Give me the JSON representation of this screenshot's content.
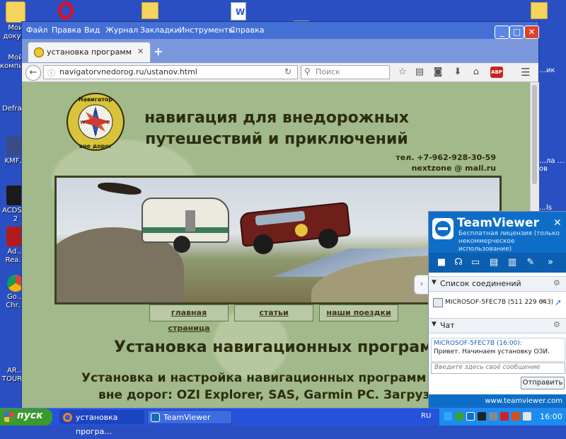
{
  "desktop": {
    "icons_left": [
      "Мои доку…",
      "Мой компью…",
      "Defra…",
      "KMF…",
      "ACDS… 2",
      "Ad… Rea…",
      "Go… Chr…",
      "AR… TOUR…"
    ],
    "icons_right": [
      "…ик",
      "…ла …ов",
      "…ls"
    ]
  },
  "firefox": {
    "menu": [
      "Файл",
      "Правка",
      "Вид",
      "Журнал",
      "Закладки",
      "Инструменты",
      "Справка"
    ],
    "tab_title": "установка программ",
    "url": "navigatorvnedorog.ru/ustanov.html",
    "search_placeholder": "Поиск",
    "abp_badge": "ABP"
  },
  "page": {
    "logo_top": "Навигатор",
    "logo_bottom": "вне дорог",
    "compass_letters": {
      "n": "N",
      "s": "S",
      "e": "E",
      "w": "W"
    },
    "headline_line1": "навигация для внедорожных",
    "headline_line2": "путешествий и приключений",
    "phone": "тел. +7-962-928-30-59",
    "email": "nextzone @ mail.ru",
    "nav": [
      "главная страница",
      "статьи",
      "наши поездки"
    ],
    "title": "Установка навигационных програм",
    "subtitle_line1": "Установка и настройка навигационных программ дл",
    "subtitle_line2": "вне дорог: OZI Explorer, SAS, Garmin PC. Загрузка"
  },
  "teamviewer": {
    "brand": "TeamViewer",
    "license": "Бесплатная лицензия (только некоммерческое использование)",
    "connections_header": "Список соединений",
    "connection_item": "MICROSOF-5FEC7B (511 229 643)",
    "chat_header": "Чат",
    "chat_sender": "MICROSOF-5FEC7B (16:00):",
    "chat_message": "Привет. Начинаем установку ОЗИ.",
    "chat_input_placeholder": "Введите здесь своё сообщение",
    "send_button": "Отправить",
    "website": "www.teamviewer.com"
  },
  "taskbar": {
    "start": "пуск",
    "tasks": [
      "установка програ…",
      "TeamViewer"
    ],
    "language": "RU",
    "clock": "16:00"
  },
  "colors": {
    "page_bg": "#a2b98b",
    "headline": "#2b2d10",
    "tv_blue": "#0e6ec7",
    "taskbar": "#2653d9",
    "start_green": "#3a9a2c"
  }
}
